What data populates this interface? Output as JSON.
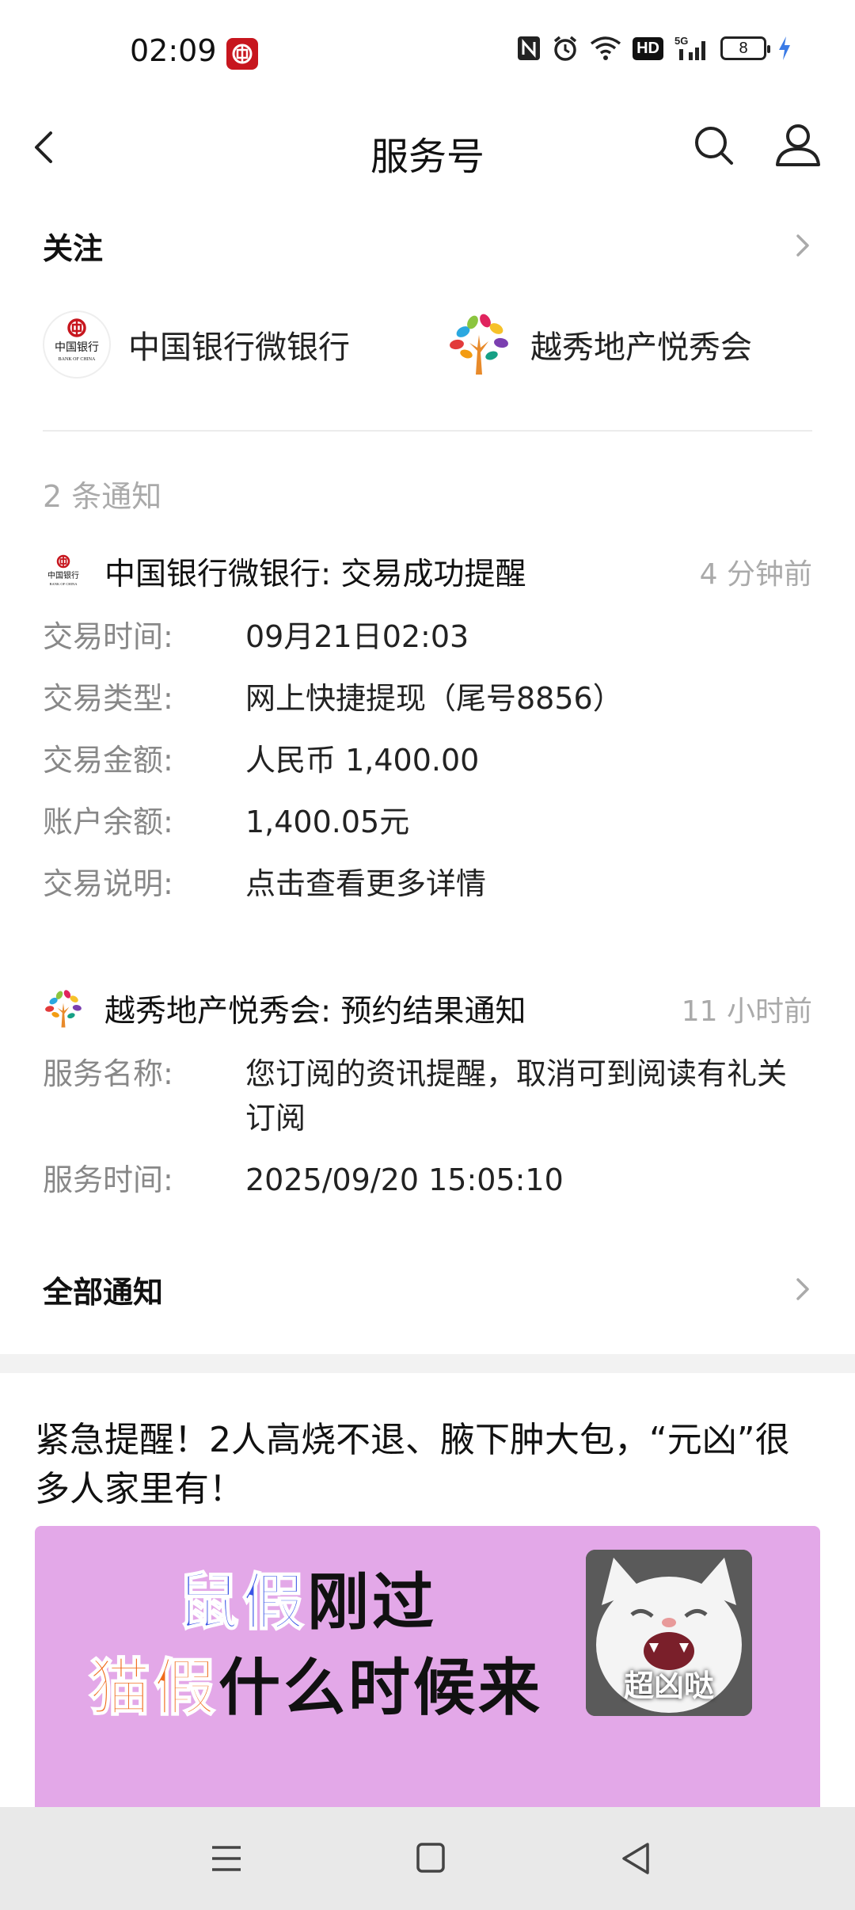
{
  "status_bar": {
    "time": "02:09",
    "battery": "8",
    "network": "5G",
    "hd": "HD"
  },
  "nav": {
    "title": "服务号"
  },
  "follow": {
    "header": "关注",
    "items": [
      {
        "name": "中国银行微银行",
        "logo_text": "中国银行",
        "logo_sub": "BANK OF CHINA"
      },
      {
        "name": "越秀地产悦秀会"
      }
    ]
  },
  "notices": {
    "count_label": "2 条通知",
    "items": [
      {
        "title": "中国银行微银行: 交易成功提醒",
        "time": "4 分钟前",
        "logo_text": "中国银行",
        "logo_sub": "BANK OF CHINA",
        "fields": [
          {
            "key": "交易时间:",
            "value": "09月21日02:03"
          },
          {
            "key": "交易类型:",
            "value": "网上快捷提现（尾号8856）"
          },
          {
            "key": "交易金额:",
            "value": "人民币 1,400.00"
          },
          {
            "key": "账户余额:",
            "value": "1,400.05元"
          },
          {
            "key": "交易说明:",
            "value": "点击查看更多详情"
          }
        ]
      },
      {
        "title": "越秀地产悦秀会: 预约结果通知",
        "time": "11 小时前",
        "fields": [
          {
            "key": "服务名称:",
            "value": "您订阅的资讯提醒，取消可到阅读有礼关订阅"
          },
          {
            "key": "服务时间:",
            "value": "2025/09/20 15:05:10"
          }
        ]
      }
    ],
    "all_label": "全部通知"
  },
  "article": {
    "title": "紧急提醒！2人高烧不退、腋下肿大包，“元凶”很多人家里有！",
    "banner": {
      "line1_highlight": "鼠假",
      "line1_rest": "刚过",
      "line2_highlight": "猫假",
      "line2_rest": "什么时候来",
      "cat_caption": "超凶哒"
    }
  },
  "colors": {
    "boc_red": "#c7161e",
    "banner_bg": "#e3a8e8",
    "accent_blue": "#3b55e6",
    "accent_orange": "#f06a1a"
  }
}
